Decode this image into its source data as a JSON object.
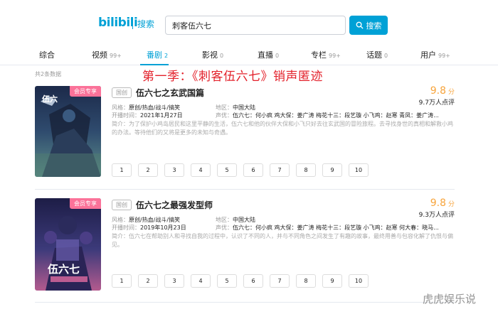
{
  "header": {
    "logo": "bilibili",
    "logo_sub": "搜索",
    "search_value": "刺客伍六七",
    "search_button": "搜索"
  },
  "tabs": [
    {
      "label": "综合",
      "count": ""
    },
    {
      "label": "视频",
      "count": "99+"
    },
    {
      "label": "番剧",
      "count": "2"
    },
    {
      "label": "影视",
      "count": "0"
    },
    {
      "label": "直播",
      "count": "0"
    },
    {
      "label": "专栏",
      "count": "99+"
    },
    {
      "label": "话题",
      "count": "0"
    },
    {
      "label": "用户",
      "count": "99+"
    }
  ],
  "result_count": "共2条数据",
  "overlay_title": "第一季：《刺客伍六七》销声匿迹",
  "items": [
    {
      "badge": "会员专享",
      "type": "国创",
      "title": "伍六七之玄武国篇",
      "score": "9.8",
      "score_unit": "分",
      "reviews": "9.7万人点评",
      "style_label": "风格：",
      "style": "原创/热血/战斗/搞笑",
      "region_label": "地区：",
      "region": "中国大陆",
      "date_label": "开播时间：",
      "date": "2021年1月27日",
      "cast_label": "声优：",
      "cast": "伍六七：何小疯 鸡大保：姜广涛 梅花十三：段艺璇 小飞鸡：赵寒 青凤：姜广涛...",
      "desc": "简介：为了保护小鸡岛居民和这里平静的生活，伍六七和他的伙伴大保和小飞只好去往玄武国的冒险旅程。去寻找身世的真相和解救小鸡的办法。等待他们的又将是更多的未知与奇遇。",
      "episodes": [
        "1",
        "2",
        "3",
        "4",
        "5",
        "6",
        "7",
        "8",
        "9",
        "10"
      ]
    },
    {
      "badge": "会员专享",
      "type": "国创",
      "title": "伍六七之最强发型师",
      "score": "9.8",
      "score_unit": "分",
      "reviews": "9.3万人点评",
      "style_label": "风格：",
      "style": "原创/热血/战斗/搞笑",
      "region_label": "地区：",
      "region": "中国大陆",
      "date_label": "开播时间：",
      "date": "2019年10月23日",
      "cast_label": "声优：",
      "cast": "伍六七：何小疯 鸡大保：姜广涛 梅花十三：段艺璇 小飞鸡：赵寒 何大春：晓马...",
      "desc": "简介：伍六七在帮助别人和寻找自我的过程中，认识了不同的人，并与不同角色之间发生了有趣的故事，最终用善与包容化解了仇恨与偏见。",
      "episodes": [
        "1",
        "2",
        "3",
        "4",
        "5",
        "6",
        "7",
        "8",
        "9",
        "10"
      ]
    }
  ],
  "watermark": "虎虎娱乐说",
  "colors": {
    "accent": "#00a1d6",
    "score": "#f7a43b",
    "badge": "#fb7299",
    "overlay": "#e3212b"
  }
}
